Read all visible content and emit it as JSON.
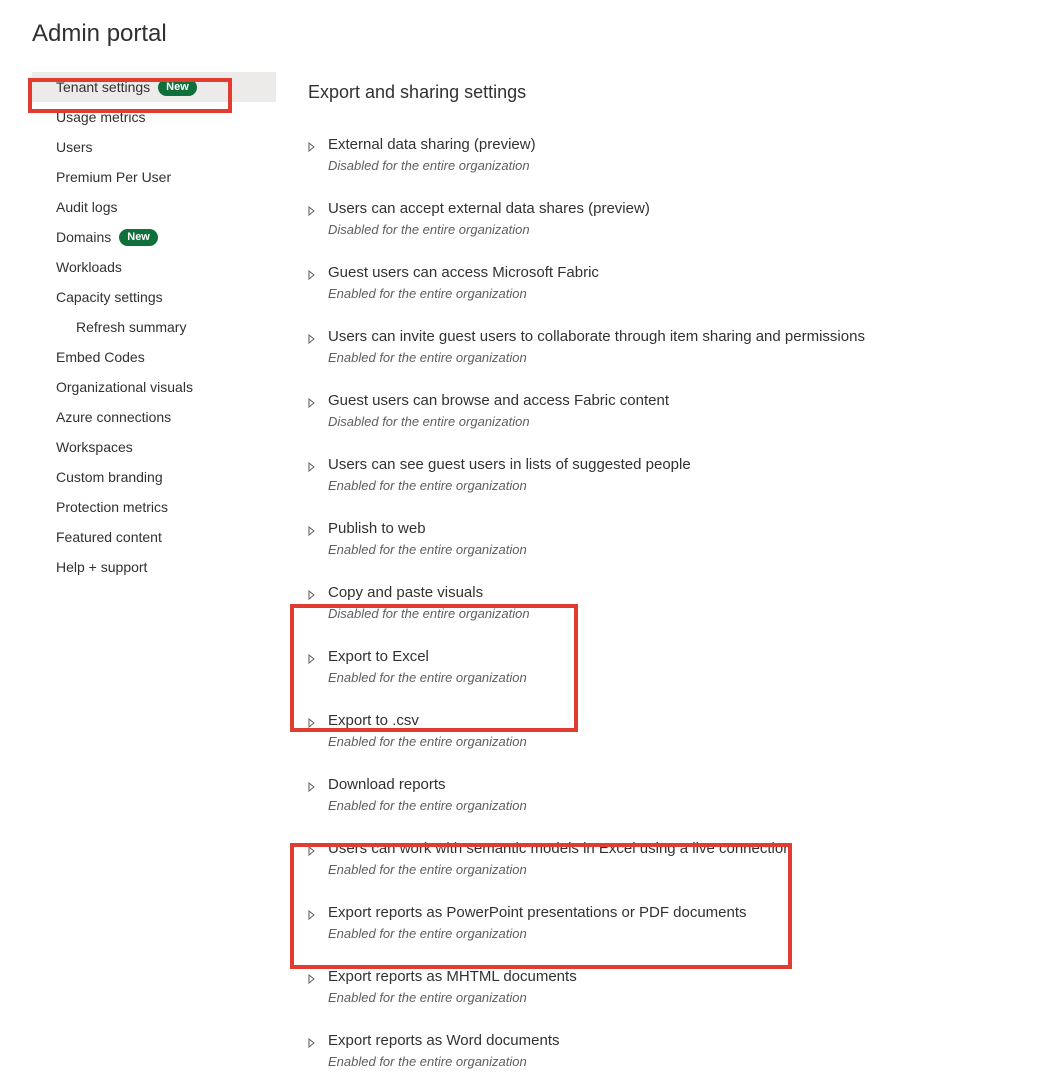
{
  "page_title": "Admin portal",
  "badge_new": "New",
  "sidebar": {
    "items": [
      {
        "label": "Tenant settings",
        "badge": true,
        "selected": true
      },
      {
        "label": "Usage metrics"
      },
      {
        "label": "Users"
      },
      {
        "label": "Premium Per User"
      },
      {
        "label": "Audit logs"
      },
      {
        "label": "Domains",
        "badge": true
      },
      {
        "label": "Workloads"
      },
      {
        "label": "Capacity settings"
      },
      {
        "label": "Refresh summary",
        "indent": true
      },
      {
        "label": "Embed Codes"
      },
      {
        "label": "Organizational visuals"
      },
      {
        "label": "Azure connections"
      },
      {
        "label": "Workspaces"
      },
      {
        "label": "Custom branding"
      },
      {
        "label": "Protection metrics"
      },
      {
        "label": "Featured content"
      },
      {
        "label": "Help + support"
      }
    ]
  },
  "main": {
    "section_title": "Export and sharing settings",
    "status": {
      "enabled": "Enabled for the entire organization",
      "disabled": "Disabled for the entire organization"
    },
    "settings": [
      {
        "label": "External data sharing (preview)",
        "enabled": false
      },
      {
        "label": "Users can accept external data shares (preview)",
        "enabled": false
      },
      {
        "label": "Guest users can access Microsoft Fabric",
        "enabled": true
      },
      {
        "label": "Users can invite guest users to collaborate through item sharing and permissions",
        "enabled": true
      },
      {
        "label": "Guest users can browse and access Fabric content",
        "enabled": false
      },
      {
        "label": "Users can see guest users in lists of suggested people",
        "enabled": true
      },
      {
        "label": "Publish to web",
        "enabled": true
      },
      {
        "label": "Copy and paste visuals",
        "enabled": false
      },
      {
        "label": "Export to Excel",
        "enabled": true
      },
      {
        "label": "Export to .csv",
        "enabled": true
      },
      {
        "label": "Download reports",
        "enabled": true
      },
      {
        "label": "Users can work with semantic models in Excel using a live connection",
        "enabled": true
      },
      {
        "label": "Export reports as PowerPoint presentations or PDF documents",
        "enabled": true
      },
      {
        "label": "Export reports as MHTML documents",
        "enabled": true
      },
      {
        "label": "Export reports as Word documents",
        "enabled": true
      }
    ]
  }
}
